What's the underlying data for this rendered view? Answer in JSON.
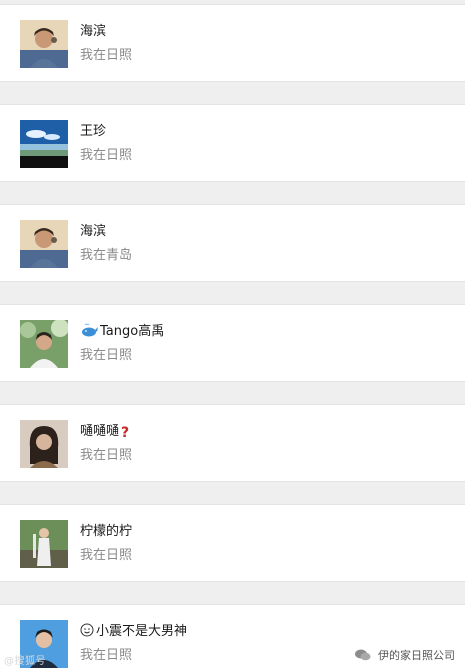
{
  "contacts": [
    {
      "name": "海滨",
      "status": "我在日照",
      "avatar": "young-man-portrait-icon"
    },
    {
      "name": "王珍",
      "status": "我在日照",
      "avatar": "sky-landscape-icon"
    },
    {
      "name": "海滨",
      "status": "我在青岛",
      "avatar": "young-man-portrait-icon"
    },
    {
      "name": "Tango高禹",
      "status": "我在日照",
      "avatar": "man-outdoor-portrait-icon",
      "prefix_icon": "whale-icon"
    },
    {
      "name": "嗵嗵嗵",
      "status": "我在日照",
      "avatar": "woman-portrait-icon",
      "suffix_icon": "question-mark-icon"
    },
    {
      "name": "柠檬的柠",
      "status": "我在日照",
      "avatar": "woman-garden-portrait-icon"
    },
    {
      "name": "小震不是大男神",
      "status": "我在日照",
      "avatar": "man-blue-portrait-icon",
      "prefix_icon": "smiley-face-icon"
    }
  ],
  "footer": {
    "account": "伊的家日照公司",
    "icon": "wechat-icon"
  },
  "watermark": "@搜狐号"
}
